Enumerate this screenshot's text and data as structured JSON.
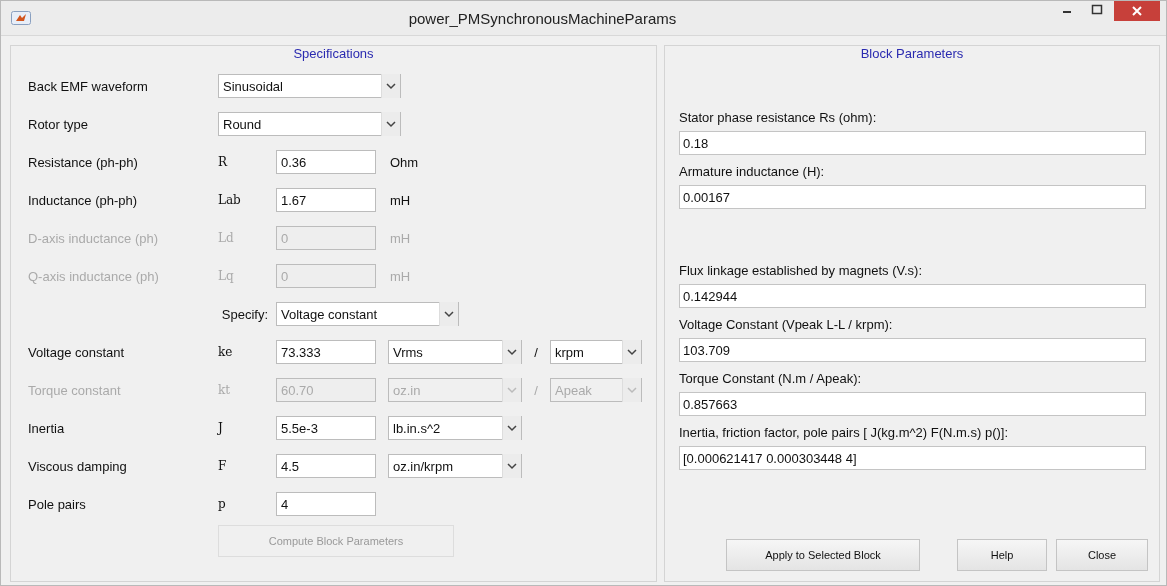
{
  "window": {
    "title": "power_PMSynchronousMachineParams"
  },
  "specifications": {
    "title": "Specifications",
    "rows": [
      {
        "kind": "dropdown",
        "label": "Back EMF waveform",
        "value": "Sinusoidal",
        "disabled": false
      },
      {
        "kind": "dropdown",
        "label": "Rotor type",
        "value": "Round",
        "disabled": false
      },
      {
        "kind": "param",
        "label": "Resistance (ph-ph)",
        "symbol": "R",
        "value": "0.36",
        "unit": "Ohm",
        "disabled": false
      },
      {
        "kind": "param",
        "label": "Inductance (ph-ph)",
        "symbol": "Lab",
        "value": "1.67",
        "unit": "mH",
        "disabled": false
      },
      {
        "kind": "param",
        "label": "D-axis inductance (ph)",
        "symbol": "Ld",
        "value": "0",
        "unit": "mH",
        "disabled": true
      },
      {
        "kind": "param",
        "label": "Q-axis inductance (ph)",
        "symbol": "Lq",
        "value": "0",
        "unit": "mH",
        "disabled": true
      },
      {
        "kind": "specify",
        "label": "Specify:",
        "value": "Voltage constant",
        "disabled": false
      },
      {
        "kind": "param",
        "label": "Voltage constant",
        "symbol": "ke",
        "value": "73.333",
        "unit_dropdowns": [
          "Vrms",
          "krpm"
        ],
        "separator": "/",
        "disabled": false
      },
      {
        "kind": "param",
        "label": "Torque constant",
        "symbol": "kt",
        "value": "60.70",
        "unit_dropdowns": [
          "oz.in",
          "Apeak"
        ],
        "separator": "/",
        "disabled": true
      },
      {
        "kind": "param",
        "label": "Inertia",
        "symbol": "J",
        "value": "5.5e-3",
        "unit_dropdowns": [
          "lb.in.s^2"
        ],
        "disabled": false
      },
      {
        "kind": "param",
        "label": "Viscous damping",
        "symbol": "F",
        "value": "4.5",
        "unit_dropdowns": [
          "oz.in/krpm"
        ],
        "disabled": false
      },
      {
        "kind": "param",
        "label": "Pole pairs",
        "symbol": "p",
        "value": "4",
        "disabled": false
      }
    ],
    "compute_button": {
      "label": "Compute Block Parameters",
      "disabled": true
    }
  },
  "block_parameters": {
    "title": "Block Parameters",
    "groups": [
      [
        {
          "label": "Stator phase resistance Rs (ohm):",
          "value": "0.18"
        },
        {
          "label": "Armature inductance (H):",
          "value": "0.00167"
        }
      ],
      [
        {
          "label": "Flux linkage established by magnets (V.s):",
          "value": "0.142944"
        },
        {
          "label": "Voltage Constant (Vpeak L-L / krpm):",
          "value": "103.709"
        },
        {
          "label": "Torque Constant (N.m / Apeak):",
          "value": "0.857663"
        },
        {
          "label": "Inertia, friction factor, pole pairs [ J(kg.m^2)  F(N.m.s)  p()]:",
          "value": "[0.000621417 0.000303448 4]"
        }
      ]
    ],
    "buttons": [
      "Apply to Selected Block",
      "Help",
      "Close"
    ]
  }
}
